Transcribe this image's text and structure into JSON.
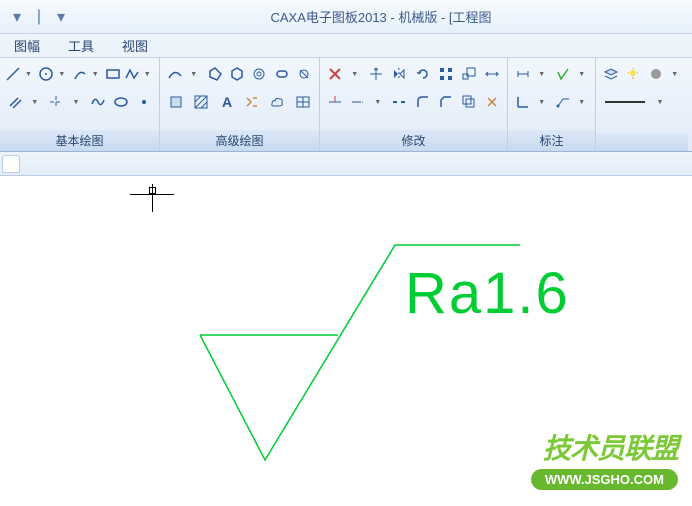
{
  "title": "CAXA电子图板2013 - 机械版 - [工程图",
  "menus": {
    "m1": "图幅",
    "m2": "工具",
    "m3": "视图"
  },
  "panels": {
    "p1": "基本绘图",
    "p2": "高级绘图",
    "p3": "修改",
    "p4": "标注"
  },
  "surface": {
    "label": "Ra1.6"
  },
  "watermark": {
    "name": "技术员联盟",
    "url": "WWW.JSGHO.COM"
  }
}
